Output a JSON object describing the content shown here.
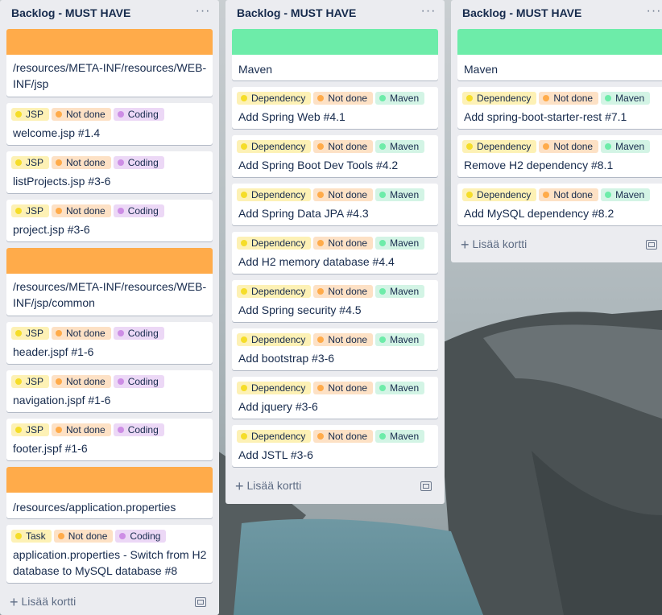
{
  "colors": {
    "cover_orange": "#ffab4a",
    "cover_green": "#6deca9",
    "label_yellow": "#fdf1b5",
    "dot_yellow": "#f5dd29",
    "label_orange": "#fde1c5",
    "dot_orange": "#ffab4a",
    "label_purple": "#ecd8f6",
    "dot_purple": "#cd8de5",
    "label_green": "#d3f4e5",
    "dot_green": "#6deca9"
  },
  "labels": {
    "jsp": "JSP",
    "not_done": "Not done",
    "coding": "Coding",
    "dependency": "Dependency",
    "maven": "Maven",
    "task": "Task"
  },
  "lists": [
    {
      "title": "Backlog - MUST HAVE",
      "menu": "···",
      "add_card": "Lisää kortti",
      "cover1": "/resources/META-INF/resources/WEB-INF/jsp",
      "cards1": [
        "welcome.jsp #1.4",
        "listProjects.jsp #3-6",
        "project.jsp #3-6"
      ],
      "cover2": "/resources/META-INF/resources/WEB-INF/jsp/common",
      "cards2": [
        "header.jspf #1-6",
        "navigation.jspf #1-6",
        "footer.jspf #1-6"
      ],
      "cover3": "/resources/application.properties",
      "cards3": [
        "application.properties - Switch from H2 database to MySQL database #8"
      ]
    },
    {
      "title": "Backlog - MUST HAVE",
      "menu": "···",
      "add_card": "Lisää kortti",
      "cover1": "Maven",
      "cards": [
        "Add Spring Web #4.1",
        "Add Spring Boot Dev Tools #4.2",
        "Add Spring Data JPA #4.3",
        "Add H2 memory database #4.4",
        "Add Spring security #4.5",
        "Add bootstrap #3-6",
        "Add jquery #3-6",
        "Add JSTL #3-6"
      ]
    },
    {
      "title": "Backlog - MUST HAVE",
      "menu": "···",
      "add_card": "Lisää kortti",
      "cover1": "Maven",
      "cards": [
        "Add spring-boot-starter-rest #7.1",
        "Remove H2 dependency #8.1",
        "Add MySQL dependency #8.2"
      ]
    }
  ]
}
